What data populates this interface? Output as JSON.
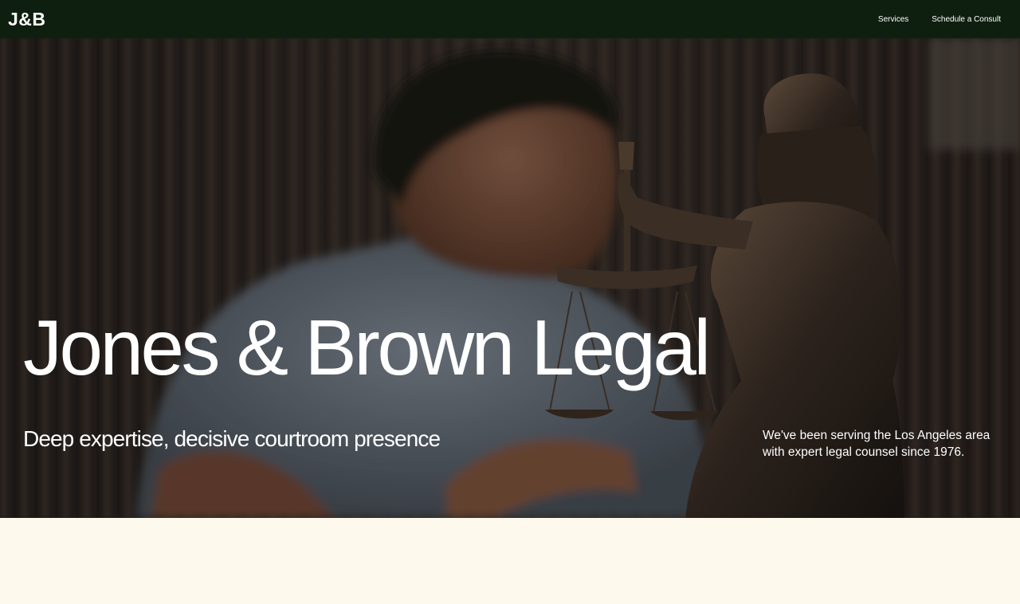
{
  "nav": {
    "logo": "J&B",
    "links": [
      {
        "label": "Services"
      },
      {
        "label": "Schedule a Consult"
      }
    ]
  },
  "hero": {
    "title": "Jones & Brown Legal",
    "tagline": "Deep expertise, decisive courtroom presence",
    "blurb": "We've been serving the Los Angeles area with expert legal counsel since 1976."
  },
  "colors": {
    "nav_bg": "#0f1f0f",
    "page_bg": "#fdf9ec",
    "text_light": "#ffffff"
  }
}
